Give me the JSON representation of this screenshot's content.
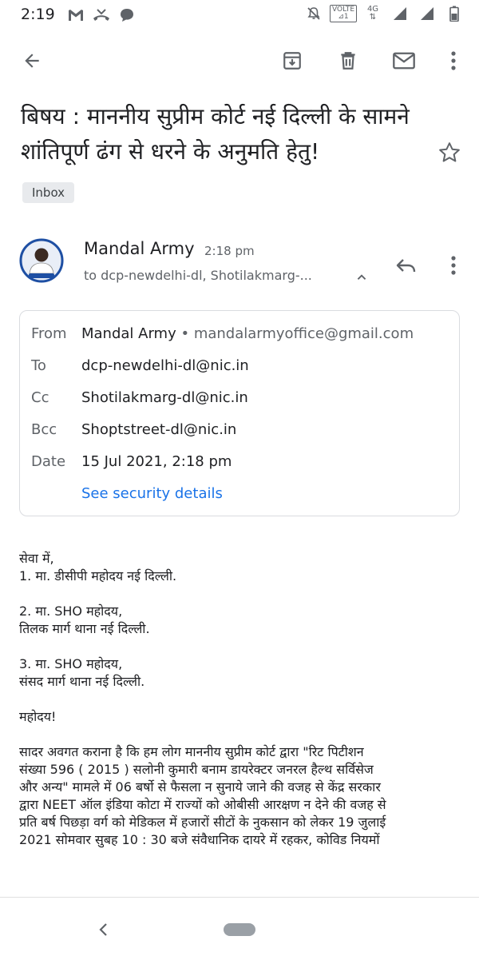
{
  "status_bar": {
    "time": "2:19",
    "volte_label": "VOLTE",
    "network_label": "4G",
    "left_icons": [
      "gmail-icon",
      "missed-call-icon",
      "chat-bubble-icon"
    ],
    "right_icons": [
      "do-not-disturb-icon",
      "volte-icon",
      "network-4g-icon",
      "signal-icon",
      "signal-icon",
      "battery-icon"
    ]
  },
  "toolbar": {
    "icons": [
      "back-arrow-icon",
      "archive-icon",
      "delete-icon",
      "mark-unread-icon",
      "more-vert-icon"
    ]
  },
  "email": {
    "subject": "बिषय : माननीय सुप्रीम कोर्ट नई दिल्ली के सामने शांतिपूर्ण ढंग से धरने के अनुमति हेतु!",
    "label": "Inbox",
    "sender_name": "Mandal Army",
    "sent_time": "2:18 pm",
    "to_summary": "to dcp-newdelhi-dl, Shotilakmarg-..."
  },
  "details": {
    "from_label": "From",
    "from_name": "Mandal Army",
    "from_separator": "•",
    "from_email": "mandalarmyoffice@gmail.com",
    "to_label": "To",
    "to_value": "dcp-newdelhi-dl@nic.in",
    "cc_label": "Cc",
    "cc_value": "Shotilakmarg-dl@nic.in",
    "bcc_label": "Bcc",
    "bcc_value": "Shoptstreet-dl@nic.in",
    "date_label": "Date",
    "date_value": "15 Jul 2021, 2:18 pm",
    "security_link": "See security details"
  },
  "body": {
    "line1": "सेवा में,",
    "line2": "1. मा. डीसीपी महोदय नई दिल्ली.",
    "line3": "2. मा. SHO महोदय,",
    "line4": "तिलक मार्ग थाना नई दिल्ली.",
    "line5": "3. मा. SHO महोदय,",
    "line6": "संसद मार्ग थाना नई दिल्ली.",
    "line7": "महोदय!",
    "paragraph_lines": [
      "सादर अवगत कराना है कि हम लोग माननीय सुप्रीम कोर्ट द्वारा \"रिट पिटीशन",
      "संख्या 596 ( 2015 ) सलोनी कुमारी बनाम डायरेक्टर जनरल हैल्थ सर्विसेज",
      "और अन्य\" मामले में 06 बर्षो से फैसला न सुनाये जाने की वजह से केंद्र सरकार",
      "द्वारा NEET ऑल इंडिया कोटा में राज्यों को ओबीसी आरक्षण न देने की वजह से",
      "प्रति बर्ष पिछड़ा वर्ग को मेडिकल में हजारों सीटों के नुकसान को लेकर 19 जुलाई",
      "2021 सोमवार सुबह 10 : 30 बजे संवैधानिक दायरे में रहकर, कोविड नियमों"
    ]
  },
  "colors": {
    "link": "#1a73e8",
    "secondary_text": "#5f6368",
    "chip_bg": "#e8eaed",
    "card_border": "#dadce0"
  }
}
